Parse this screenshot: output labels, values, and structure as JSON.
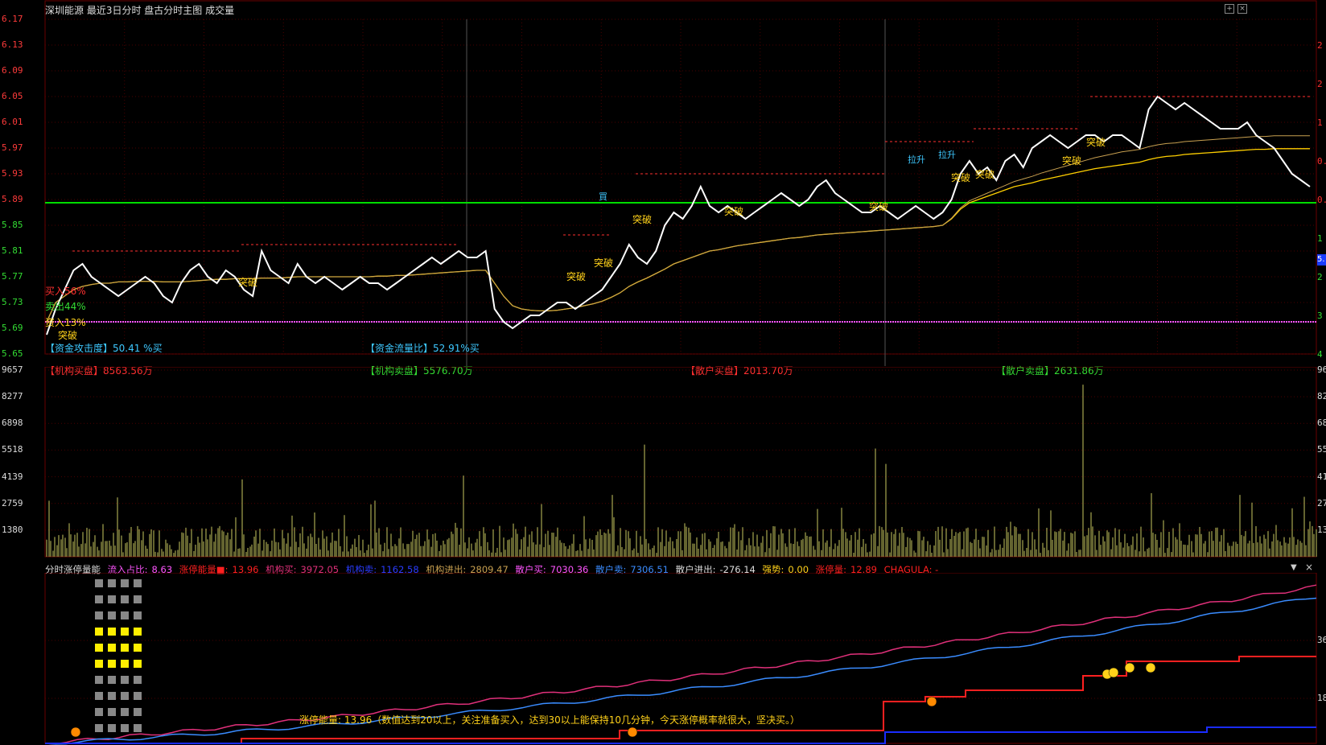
{
  "header": {
    "title": "深圳能源  最近3日分时  盘古分时主图  成交量",
    "icons": [
      "zoom-in-icon",
      "close-icon"
    ]
  },
  "price_axis": {
    "labels": [
      "6.17",
      "6.13",
      "6.09",
      "6.05",
      "6.01",
      "5.97",
      "5.93",
      "5.89",
      "5.85",
      "5.81",
      "5.77",
      "5.73",
      "5.69",
      "5.65"
    ],
    "colors": {
      "up": "#ff3b3b",
      "flat": "#dddddd",
      "down": "#33dd33"
    },
    "right_labels": [
      "2",
      "2",
      "1",
      "0.",
      "0.",
      "1",
      "2",
      "3",
      "4"
    ]
  },
  "volume_axis": {
    "labels": [
      "9657",
      "8277",
      "6898",
      "5518",
      "4139",
      "2759",
      "1380"
    ],
    "right_labels": [
      "96",
      "82",
      "68",
      "55",
      "41",
      "27",
      "13"
    ]
  },
  "indicator_axis": {
    "right_labels": [
      "36",
      "18"
    ]
  },
  "price_annotations": {
    "buy_pct": "买入56%",
    "mid_pct": "卖出44%",
    "low_pct": "资入13%",
    "breakout": "突破",
    "labels_top": [
      "買",
      "拉升",
      "拉升"
    ],
    "info_left": "【资金攻击度】50.41 %买",
    "info_mid": "【资金流量比】52.91%买",
    "inst_buy": "【机构买盘】8563.56万",
    "inst_sell": "【机构卖盘】5576.70万",
    "retail_buy": "【散户买盘】2013.70万",
    "retail_sell": "【散户卖盘】2631.86万"
  },
  "indicator_header": {
    "name": "分时涨停量能",
    "inflow_label": "流入占比:",
    "inflow_value": "8.63",
    "limit_energy_label": "涨停能量■:",
    "limit_energy_value": "13.96",
    "inst_buy_label": "机构买:",
    "inst_buy_value": "3972.05",
    "inst_sell_label": "机构卖:",
    "inst_sell_value": "1162.58",
    "inst_net_label": "机构进出:",
    "inst_net_value": "2809.47",
    "retail_buy_label": "散户买:",
    "retail_buy_value": "7030.36",
    "retail_sell_label": "散户卖:",
    "retail_sell_value": "7306.51",
    "retail_net_label": "散户进出:",
    "retail_net_value": "-276.14",
    "strength_label": "强势:",
    "strength_value": "0.00",
    "limit_vol_label": "涨停量:",
    "limit_vol_value": "12.89",
    "chagula": "CHAGULA: -"
  },
  "message": "涨停能量: 13.96（数值达到20以上，关注准备买入，达到30以上能保持10几分钟，今天涨停概率就很大，坚决买。）",
  "colors": {
    "price_line": "#ffffff",
    "avg_line": "#ffd000",
    "avg_line2": "#c8a050",
    "green_level": "#00dd00",
    "pink_level": "#ff55ff",
    "volume": "#c8c860",
    "indicator_pink": "#e0307a",
    "indicator_blue": "#3a8cff",
    "indicator_red": "#ff2020",
    "indicator_darkblue": "#1a2cff",
    "grid": "#4a0000"
  },
  "chart_data": {
    "type": "line",
    "title": "深圳能源 最近3日分时",
    "ylim": [
      5.65,
      6.17
    ],
    "y_ticks": [
      6.17,
      6.13,
      6.09,
      6.05,
      6.01,
      5.97,
      5.93,
      5.89,
      5.85,
      5.81,
      5.77,
      5.73,
      5.69,
      5.65
    ],
    "reference_levels": {
      "prev_close": 5.885,
      "support": 5.7
    },
    "price": [
      5.68,
      5.72,
      5.75,
      5.78,
      5.79,
      5.77,
      5.76,
      5.75,
      5.74,
      5.75,
      5.76,
      5.77,
      5.76,
      5.74,
      5.73,
      5.76,
      5.78,
      5.79,
      5.77,
      5.76,
      5.78,
      5.77,
      5.75,
      5.74,
      5.81,
      5.78,
      5.77,
      5.76,
      5.79,
      5.77,
      5.76,
      5.77,
      5.76,
      5.75,
      5.76,
      5.77,
      5.76,
      5.76,
      5.75,
      5.76,
      5.77,
      5.78,
      5.79,
      5.8,
      5.79,
      5.8,
      5.81,
      5.8,
      5.8,
      5.81,
      5.72,
      5.7,
      5.69,
      5.7,
      5.71,
      5.71,
      5.72,
      5.73,
      5.73,
      5.72,
      5.73,
      5.74,
      5.75,
      5.77,
      5.79,
      5.82,
      5.8,
      5.79,
      5.81,
      5.85,
      5.87,
      5.86,
      5.88,
      5.91,
      5.88,
      5.87,
      5.88,
      5.87,
      5.86,
      5.87,
      5.88,
      5.89,
      5.9,
      5.89,
      5.88,
      5.89,
      5.91,
      5.92,
      5.9,
      5.89,
      5.88,
      5.87,
      5.87,
      5.88,
      5.87,
      5.86,
      5.87,
      5.88,
      5.87,
      5.86,
      5.87,
      5.89,
      5.93,
      5.95,
      5.93,
      5.94,
      5.92,
      5.95,
      5.96,
      5.94,
      5.97,
      5.98,
      5.99,
      5.98,
      5.97,
      5.98,
      5.99,
      5.99,
      5.98,
      5.99,
      5.99,
      5.98,
      5.97,
      6.03,
      6.05,
      6.04,
      6.03,
      6.04,
      6.03,
      6.02,
      6.01,
      6.0,
      6.0,
      6.0,
      6.01,
      5.99,
      5.98,
      5.97,
      5.95,
      5.93,
      5.92,
      5.91
    ],
    "avg_price": [
      5.7,
      5.73,
      5.74,
      5.75,
      5.755,
      5.758,
      5.76,
      5.76,
      5.762,
      5.762,
      5.763,
      5.763,
      5.763,
      5.762,
      5.762,
      5.762,
      5.763,
      5.764,
      5.765,
      5.766,
      5.766,
      5.767,
      5.767,
      5.767,
      5.768,
      5.768,
      5.768,
      5.769,
      5.77,
      5.77,
      5.77,
      5.77,
      5.77,
      5.77,
      5.77,
      5.77,
      5.77,
      5.771,
      5.771,
      5.772,
      5.772,
      5.773,
      5.774,
      5.775,
      5.776,
      5.777,
      5.778,
      5.779,
      5.78,
      5.78,
      5.76,
      5.74,
      5.725,
      5.72,
      5.718,
      5.717,
      5.717,
      5.718,
      5.72,
      5.722,
      5.725,
      5.728,
      5.732,
      5.738,
      5.745,
      5.755,
      5.762,
      5.768,
      5.775,
      5.782,
      5.79,
      5.795,
      5.8,
      5.805,
      5.81,
      5.812,
      5.815,
      5.818,
      5.82,
      5.822,
      5.824,
      5.826,
      5.828,
      5.83,
      5.831,
      5.833,
      5.835,
      5.836,
      5.837,
      5.838,
      5.839,
      5.84,
      5.841,
      5.842,
      5.843,
      5.844,
      5.845,
      5.846,
      5.847,
      5.848,
      5.85,
      5.86,
      5.875,
      5.885,
      5.89,
      5.895,
      5.9,
      5.905,
      5.91,
      5.913,
      5.916,
      5.92,
      5.923,
      5.926,
      5.929,
      5.932,
      5.935,
      5.938,
      5.94,
      5.942,
      5.944,
      5.946,
      5.948,
      5.952,
      5.955,
      5.957,
      5.958,
      5.96,
      5.961,
      5.962,
      5.963,
      5.964,
      5.965,
      5.966,
      5.967,
      5.968,
      5.968,
      5.969,
      5.969,
      5.969,
      5.969,
      5.969
    ],
    "volume_ylim": [
      0,
      9657
    ],
    "volume_ticks": [
      9657,
      8277,
      6898,
      5518,
      4139,
      2759,
      1380
    ]
  }
}
